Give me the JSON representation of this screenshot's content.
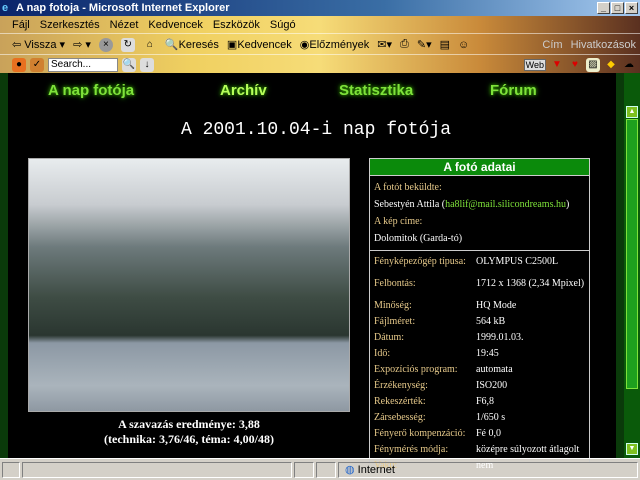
{
  "window": {
    "title": "A nap fotoja - Microsoft Internet Explorer"
  },
  "menu": [
    "Fájl",
    "Szerkesztés",
    "Nézet",
    "Kedvencek",
    "Eszközök",
    "Súgó"
  ],
  "toolbar": {
    "back": "Vissza",
    "search": "Keresés",
    "favorites": "Kedvencek",
    "history": "Előzmények",
    "address": "Cím",
    "links": "Hivatkozások"
  },
  "linkbar": {
    "search_placeholder": "Search...",
    "web": "Web"
  },
  "nav": [
    "A nap fotója",
    "Archív",
    "Statisztika",
    "Fórum"
  ],
  "heading": "A 2001.10.04-i nap fotója",
  "vote": {
    "line1": "A szavazás eredménye: 3,88",
    "line2": "(technika: 3,76/46, téma: 4,00/48)"
  },
  "info": {
    "header": "A fotó adatai",
    "sender_label": "A fotót beküldte:",
    "sender_name": "Sebestyén Attila (",
    "sender_email": "ha8lif@mail.silicondreams.hu",
    "sender_close": ")",
    "title_label": "A kép címe:",
    "title": "Dolomitok (Garda-tó)",
    "rows": [
      [
        "Fényképezőgép típusa:",
        "OLYMPUS C2500L"
      ],
      [
        "Felbontás:",
        "1712 x 1368 (2,34 Mpixel)"
      ],
      [
        "Minőség:",
        "HQ Mode"
      ],
      [
        "Fájlméret:",
        "564 kB"
      ],
      [
        "Dátum:",
        "1999.01.03."
      ],
      [
        "Idő:",
        "19:45"
      ],
      [
        "Expozíciós program:",
        "automata"
      ],
      [
        "Érzékenység:",
        "ISO200"
      ],
      [
        "Rekeszérték:",
        "F6,8"
      ],
      [
        "Zársebesség:",
        "1/650 s"
      ],
      [
        "Fényerő kompenzáció:",
        "Fé 0,0"
      ],
      [
        "Fénymérés módja:",
        "középre súlyozott átlagolt"
      ],
      [
        "Vaku:",
        "nem"
      ]
    ]
  },
  "status": {
    "zone": "Internet"
  }
}
